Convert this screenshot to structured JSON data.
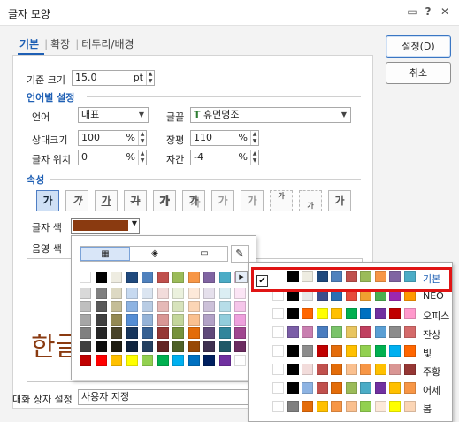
{
  "window": {
    "title": "글자 모양"
  },
  "tabs": [
    {
      "label": "기본",
      "active": true
    },
    {
      "label": "확장"
    },
    {
      "label": "테두리/배경"
    }
  ],
  "buttons": {
    "ok": "설정(D)",
    "cancel": "취소"
  },
  "base_size": {
    "label": "기준 크기",
    "value": "15.0",
    "unit": "pt"
  },
  "lang_section": {
    "title": "언어별 설정",
    "language_label": "언어",
    "language_value": "대표",
    "font_label": "글꼴",
    "font_value": "휴먼명조",
    "rel_size_label": "상대크기",
    "rel_size_value": "100",
    "rel_size_unit": "%",
    "width_label": "장평",
    "width_value": "110",
    "width_unit": "%",
    "pos_label": "글자 위치",
    "pos_value": "0",
    "pos_unit": "%",
    "spacing_label": "자간",
    "spacing_value": "-4",
    "spacing_unit": "%"
  },
  "attr_section": {
    "title": "속성",
    "buttons": [
      {
        "name": "bold",
        "glyph": "가"
      },
      {
        "name": "italic",
        "glyph": "가"
      },
      {
        "name": "underline",
        "glyph": "가"
      },
      {
        "name": "strikethrough",
        "glyph": "가"
      },
      {
        "name": "outline",
        "glyph": "가"
      },
      {
        "name": "shadow",
        "glyph": "가"
      },
      {
        "name": "emboss",
        "glyph": "가"
      },
      {
        "name": "engrave",
        "glyph": "가"
      },
      {
        "name": "superscript",
        "glyph": "가"
      },
      {
        "name": "subscript",
        "glyph": "가"
      },
      {
        "name": "normal",
        "glyph": "가"
      }
    ],
    "text_color_label": "글자 색",
    "text_color_value": "#8a3a10",
    "shade_color_label": "음영 색"
  },
  "preview": {
    "text": "한글"
  },
  "dialog_setting": {
    "label": "대화 상자 설정",
    "value": "사용자 지정"
  },
  "palette_popup": {
    "top_row": [
      "#ffffff",
      "#000000",
      "#eeece1",
      "#1f497d",
      "#4f81bd",
      "#c0504d",
      "#9bbb59",
      "#f79646",
      "#8064a2",
      "#4bacc6",
      "#f2c8e8"
    ],
    "columns": [
      [
        "#d9d9d9",
        "#bfbfbf",
        "#a6a6a6",
        "#808080",
        "#404040"
      ],
      [
        "#7f7f7f",
        "#595959",
        "#404040",
        "#262626",
        "#0d0d0d"
      ],
      [
        "#ddd9c3",
        "#c4bd97",
        "#938953",
        "#494429",
        "#1d1b10"
      ],
      [
        "#c6d9f0",
        "#8db3e2",
        "#548dd4",
        "#17365d",
        "#0f243e"
      ],
      [
        "#dbe5f1",
        "#b8cce4",
        "#95b3d7",
        "#366092",
        "#244061"
      ],
      [
        "#f2dcdb",
        "#e5b9b7",
        "#d99694",
        "#953734",
        "#632423"
      ],
      [
        "#ebf1dd",
        "#d7e3bc",
        "#c3d69b",
        "#76923c",
        "#4f6128"
      ],
      [
        "#fde9d9",
        "#fbd5b5",
        "#fac08f",
        "#e36c09",
        "#974806"
      ],
      [
        "#e5e0ec",
        "#ccc1d9",
        "#b2a2c7",
        "#5f497a",
        "#3f3151"
      ],
      [
        "#dbeef3",
        "#b7dde8",
        "#92cddc",
        "#31859b",
        "#205867"
      ],
      [
        "#fbe5f5",
        "#f5c6ea",
        "#eea1dd",
        "#a0468f",
        "#6b2c60"
      ]
    ],
    "std_row": [
      "#c00000",
      "#ff0000",
      "#ffc000",
      "#ffff00",
      "#92d050",
      "#00b050",
      "#00b0f0",
      "#0070c0",
      "#002060",
      "#7030a0",
      "#ffffff"
    ]
  },
  "theme_list": [
    {
      "name": "기본",
      "colors": [
        "#ffffff",
        "#000000",
        "#eeece1",
        "#1f497d",
        "#4f81bd",
        "#c0504d",
        "#9bbb59",
        "#f79646",
        "#8064a2",
        "#4bacc6"
      ],
      "selected": true
    },
    {
      "name": "NEO",
      "colors": [
        "#ffffff",
        "#000000",
        "#e8e8e8",
        "#3c4e8c",
        "#2a6fb4",
        "#e64c3c",
        "#f0a030",
        "#4caf50",
        "#9c27b0",
        "#ff9800"
      ]
    },
    {
      "name": "오피스",
      "colors": [
        "#ffffff",
        "#000000",
        "#ff6600",
        "#ffff00",
        "#ffc000",
        "#00b050",
        "#0070c0",
        "#7030a0",
        "#c00000",
        "#ff99cc"
      ]
    },
    {
      "name": "잔상",
      "colors": [
        "#ffffff",
        "#7b5ea7",
        "#c97fb0",
        "#4a7dbf",
        "#7ac36a",
        "#e8c560",
        "#c04060",
        "#5a9fd4",
        "#8c8c8c",
        "#d46a6a"
      ]
    },
    {
      "name": "빛",
      "colors": [
        "#ffffff",
        "#000000",
        "#8c8c8c",
        "#c00000",
        "#e46c0a",
        "#ffc000",
        "#92d050",
        "#00b050",
        "#00b0f0",
        "#ff6600"
      ]
    },
    {
      "name": "주황",
      "colors": [
        "#ffffff",
        "#000000",
        "#f2dcdb",
        "#c0504d",
        "#e36c09",
        "#fac08f",
        "#f79646",
        "#ffc000",
        "#d99694",
        "#953734"
      ]
    },
    {
      "name": "어제",
      "colors": [
        "#ffffff",
        "#000000",
        "#8db3e2",
        "#c0504d",
        "#e36c09",
        "#9bbb59",
        "#4bacc6",
        "#7030a0",
        "#ffc000",
        "#f79646"
      ]
    },
    {
      "name": "봄",
      "colors": [
        "#ffffff",
        "#808080",
        "#e46c0a",
        "#ffc000",
        "#f79646",
        "#fac08f",
        "#92d050",
        "#fde9d9",
        "#ffff00",
        "#fbd5b5"
      ]
    }
  ]
}
